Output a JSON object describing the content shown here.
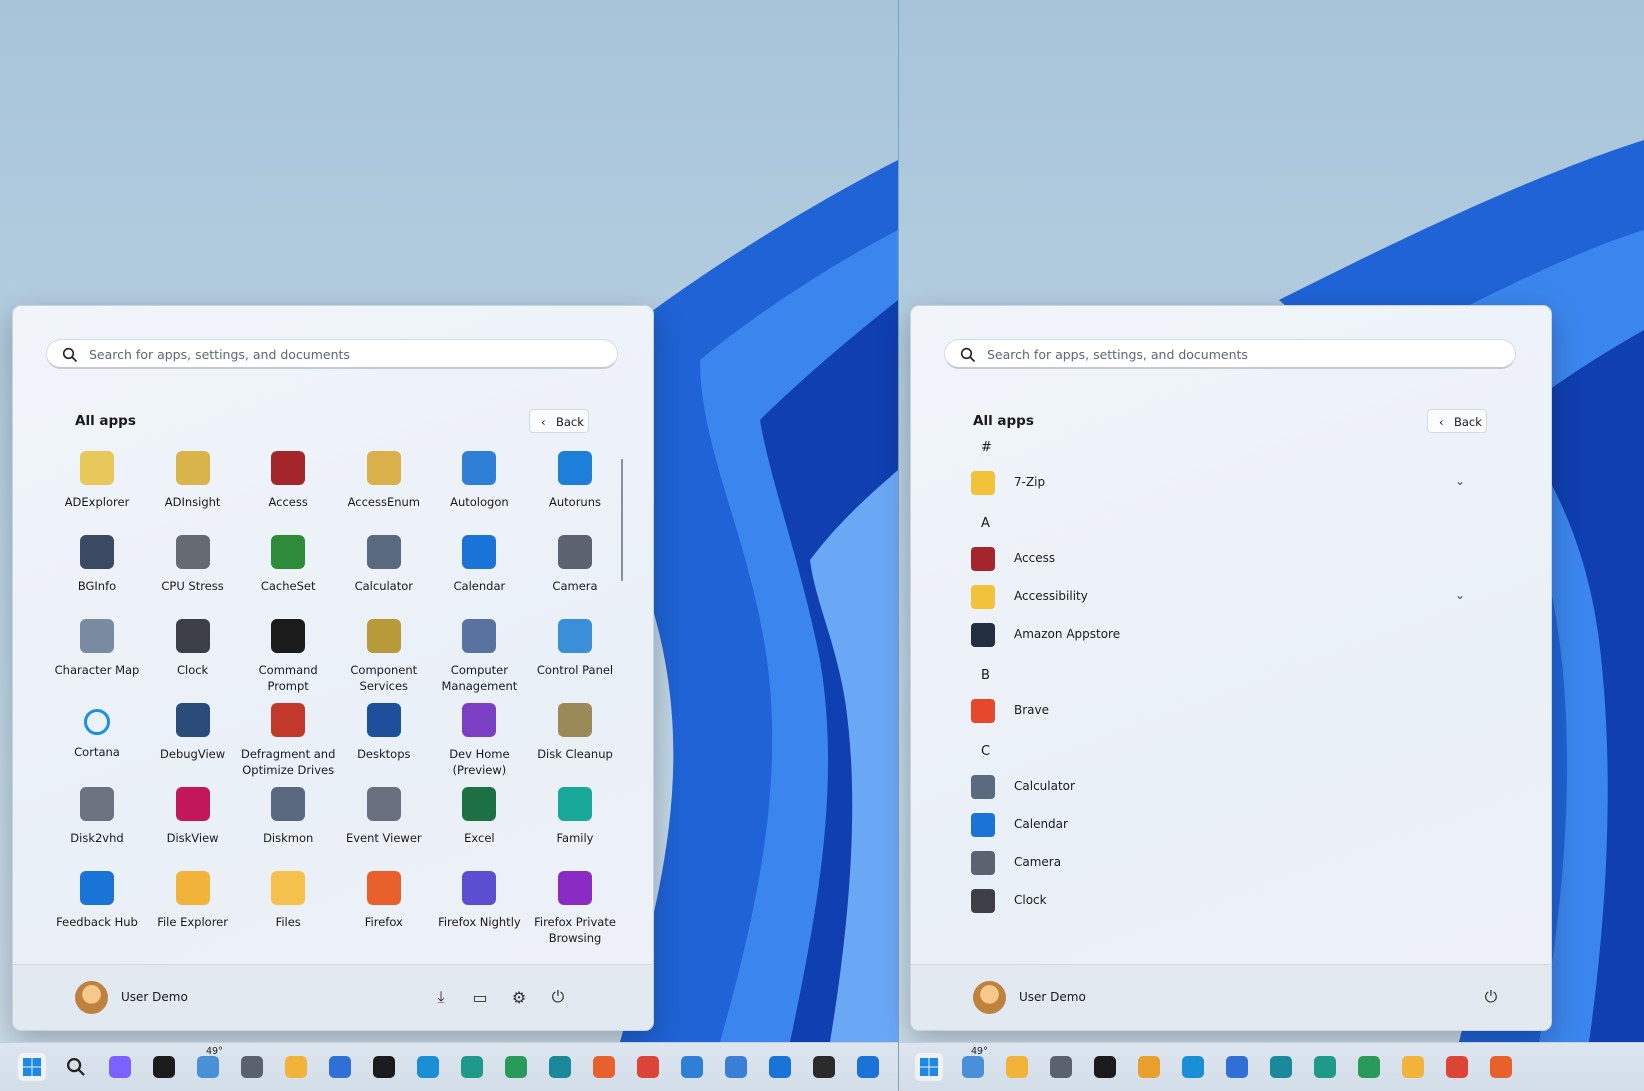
{
  "search": {
    "placeholder": "Search for apps, settings, and documents"
  },
  "panels": {
    "heading": "All apps",
    "back_label": "Back",
    "user_name": "User Demo"
  },
  "grid_apps": [
    {
      "label": "ADExplorer",
      "icon": "book-icon",
      "color": "#e8c85a"
    },
    {
      "label": "ADInsight",
      "icon": "magnifier-icon",
      "color": "#d8b44a"
    },
    {
      "label": "Access",
      "icon": "access-icon",
      "color": "#a4262c"
    },
    {
      "label": "AccessEnum",
      "icon": "key-icon",
      "color": "#d9b04a"
    },
    {
      "label": "Autologon",
      "icon": "autologon-icon",
      "color": "#2f7fd6"
    },
    {
      "label": "Autoruns",
      "icon": "autoruns-icon",
      "color": "#1e7fd8"
    },
    {
      "label": "BGInfo",
      "icon": "info-monitor-icon",
      "color": "#3b4a62"
    },
    {
      "label": "CPU Stress",
      "icon": "chip-icon",
      "color": "#666b73"
    },
    {
      "label": "CacheSet",
      "icon": "cacheset-icon",
      "color": "#2f8a3a"
    },
    {
      "label": "Calculator",
      "icon": "calculator-icon",
      "color": "#5a6b80"
    },
    {
      "label": "Calendar",
      "icon": "calendar-icon",
      "color": "#1a73d6"
    },
    {
      "label": "Camera",
      "icon": "camera-icon",
      "color": "#5b6270"
    },
    {
      "label": "Character Map",
      "icon": "charmap-icon",
      "color": "#7a8aa0"
    },
    {
      "label": "Clock",
      "icon": "clock-icon",
      "color": "#3c3f45"
    },
    {
      "label": "Command\nPrompt",
      "icon": "terminal-icon",
      "color": "#1b1b1b"
    },
    {
      "label": "Component\nServices",
      "icon": "component-icon",
      "color": "#b89a3a"
    },
    {
      "label": "Computer\nManagement",
      "icon": "computer-management-icon",
      "color": "#5873a0"
    },
    {
      "label": "Control Panel",
      "icon": "control-panel-icon",
      "color": "#3a8fd8"
    },
    {
      "label": "Cortana",
      "icon": "cortana-icon",
      "color": "#ffffff"
    },
    {
      "label": "DebugView",
      "icon": "bug-icon",
      "color": "#2b4b7a"
    },
    {
      "label": "Defragment and\nOptimize Drives",
      "icon": "defrag-icon",
      "color": "#c0392b"
    },
    {
      "label": "Desktops",
      "icon": "desktops-icon",
      "color": "#1f4f9a"
    },
    {
      "label": "Dev Home\n(Preview)",
      "icon": "dev-home-icon",
      "color": "#7b3fc4"
    },
    {
      "label": "Disk Cleanup",
      "icon": "disk-cleanup-icon",
      "color": "#9a8a5a"
    },
    {
      "label": "Disk2vhd",
      "icon": "disk2vhd-icon",
      "color": "#6b7380"
    },
    {
      "label": "DiskView",
      "icon": "diskview-icon",
      "color": "#c2185b"
    },
    {
      "label": "Diskmon",
      "icon": "diskmon-icon",
      "color": "#5a6880"
    },
    {
      "label": "Event Viewer",
      "icon": "event-viewer-icon",
      "color": "#6b7080"
    },
    {
      "label": "Excel",
      "icon": "excel-icon",
      "color": "#1d7044"
    },
    {
      "label": "Family",
      "icon": "family-icon",
      "color": "#17a89a"
    },
    {
      "label": "Feedback Hub",
      "icon": "feedback-icon",
      "color": "#1a73d6"
    },
    {
      "label": "File Explorer",
      "icon": "folder-icon",
      "color": "#f2b33a"
    },
    {
      "label": "Files",
      "icon": "files-icon",
      "color": "#f3c14c"
    },
    {
      "label": "Firefox",
      "icon": "firefox-icon",
      "color": "#e8602c"
    },
    {
      "label": "Firefox Nightly",
      "icon": "firefox-nightly-icon",
      "color": "#5a4fd0"
    },
    {
      "label": "Firefox Private\nBrowsing",
      "icon": "firefox-private-icon",
      "color": "#8a2bc4"
    }
  ],
  "list_sections": [
    {
      "letter": "#",
      "items": [
        {
          "label": "7-Zip",
          "icon": "folder-icon",
          "color": "#f2c33a",
          "expand": true
        }
      ]
    },
    {
      "letter": "A",
      "items": [
        {
          "label": "Access",
          "icon": "access-icon",
          "color": "#a4262c",
          "expand": false
        },
        {
          "label": "Accessibility",
          "icon": "folder-icon",
          "color": "#f2c33a",
          "expand": true
        },
        {
          "label": "Amazon Appstore",
          "icon": "appstore-icon",
          "color": "#232f3e",
          "expand": false
        }
      ]
    },
    {
      "letter": "B",
      "items": [
        {
          "label": "Brave",
          "icon": "brave-icon",
          "color": "#e5482a",
          "expand": false
        }
      ]
    },
    {
      "letter": "C",
      "items": [
        {
          "label": "Calculator",
          "icon": "calculator-icon",
          "color": "#5a6b80",
          "expand": false
        },
        {
          "label": "Calendar",
          "icon": "calendar-icon",
          "color": "#1a73d6",
          "expand": false
        },
        {
          "label": "Camera",
          "icon": "camera-icon",
          "color": "#5b6270",
          "expand": false
        },
        {
          "label": "Clock",
          "icon": "clock-icon",
          "color": "#3c3f45",
          "expand": false
        }
      ]
    }
  ],
  "weather": {
    "temp": "49°"
  },
  "taskbar_left": [
    {
      "icon": "start-icon",
      "color": "#1e88e5"
    },
    {
      "icon": "search-icon",
      "color": "#222222"
    },
    {
      "icon": "copilot-icon",
      "color": "#7b61ff"
    },
    {
      "icon": "task-view-icon",
      "color": "#1b1b1b"
    },
    {
      "icon": "weather-icon",
      "color": "#4a90d9"
    },
    {
      "icon": "settings-icon",
      "color": "#5a6270"
    },
    {
      "icon": "file-explorer-icon",
      "color": "#f2b33a"
    },
    {
      "icon": "store-icon",
      "color": "#2f6fd6"
    },
    {
      "icon": "terminal-icon",
      "color": "#1b1b1b"
    },
    {
      "icon": "edge-icon",
      "color": "#1a8fd6"
    },
    {
      "icon": "edge-beta-icon",
      "color": "#1f9a8a"
    },
    {
      "icon": "edge-dev-icon",
      "color": "#2a9a5a"
    },
    {
      "icon": "edge-canary-icon",
      "color": "#1a8a9a"
    },
    {
      "icon": "firefox-icon",
      "color": "#e8602c"
    },
    {
      "icon": "chrome-icon",
      "color": "#db4437"
    },
    {
      "icon": "photos-icon",
      "color": "#2f7fd6"
    },
    {
      "icon": "notepad-icon",
      "color": "#3a7fd6"
    },
    {
      "icon": "tips-icon",
      "color": "#1a73d6"
    },
    {
      "icon": "solitaire-icon",
      "color": "#2a2a2a"
    },
    {
      "icon": "calendar-icon",
      "color": "#1a73d6"
    }
  ],
  "taskbar_right": [
    {
      "icon": "start-icon",
      "color": "#1e88e5"
    },
    {
      "icon": "weather-icon",
      "color": "#4a90d9"
    },
    {
      "icon": "file-explorer-icon",
      "color": "#f2b33a"
    },
    {
      "icon": "settings-icon",
      "color": "#5a6270"
    },
    {
      "icon": "terminal-icon",
      "color": "#1b1b1b"
    },
    {
      "icon": "paint-icon",
      "color": "#e8a02c"
    },
    {
      "icon": "edge-icon",
      "color": "#1a8fd6"
    },
    {
      "icon": "store-icon",
      "color": "#2f6fd6"
    },
    {
      "icon": "edge-canary-icon",
      "color": "#1a8a9a"
    },
    {
      "icon": "edge-beta-icon",
      "color": "#1f9a8a"
    },
    {
      "icon": "edge-dev-icon",
      "color": "#2a9a5a"
    },
    {
      "icon": "chrome-canary-icon",
      "color": "#f2b33a"
    },
    {
      "icon": "chrome-icon",
      "color": "#db4437"
    },
    {
      "icon": "firefox-icon",
      "color": "#e8602c"
    }
  ]
}
